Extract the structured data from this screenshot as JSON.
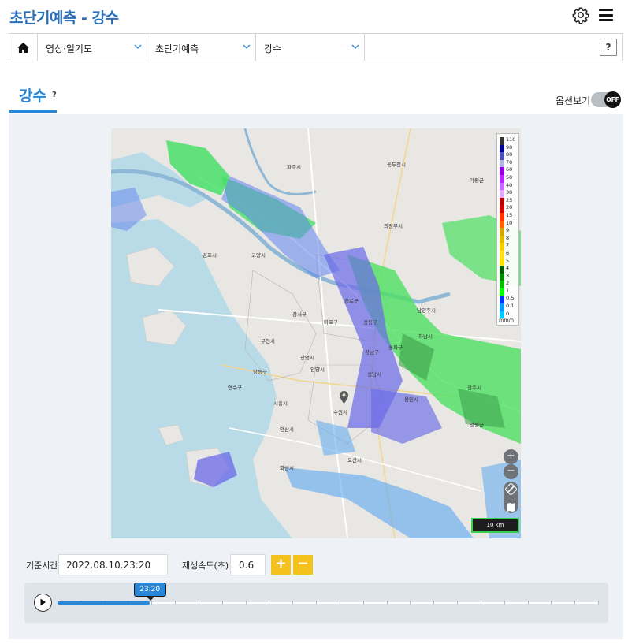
{
  "header": {
    "title": "초단기예측 - 강수",
    "settings_icon": "gear-icon",
    "menu_icon": "hamburger-menu-icon"
  },
  "breadcrumb": {
    "home_icon": "home-icon",
    "items": [
      {
        "label": "영상·일기도"
      },
      {
        "label": "초단기예측"
      },
      {
        "label": "강수"
      }
    ],
    "help_label": "?"
  },
  "tab": {
    "title": "강수",
    "help": "?"
  },
  "options": {
    "label": "옵션보기",
    "toggle_state": "OFF"
  },
  "map": {
    "legend": {
      "values": [
        "110",
        "90",
        "80",
        "70",
        "60",
        "50",
        "40",
        "30",
        "25",
        "20",
        "15",
        "10",
        "9",
        "8",
        "7",
        "6",
        "5",
        "4",
        "3",
        "2",
        "1",
        "0.5",
        "0.1",
        "0"
      ],
      "colors": [
        "#333333",
        "#000390",
        "#4c4eb1",
        "#b3b4de",
        "#9300e4",
        "#b329ff",
        "#c969ff",
        "#e0a9ff",
        "#b40000",
        "#d20000",
        "#ff3200",
        "#ff6600",
        "#ccaa00",
        "#e0b900",
        "#f9cd00",
        "#ffdc1f",
        "#ffe100",
        "#005a00",
        "#008c00",
        "#00be00",
        "#00ff00",
        "#0033ff",
        "#009bf5",
        "#00c8ff"
      ],
      "unit": "mm/h"
    },
    "zoom_in": "+",
    "zoom_out": "−",
    "ruler_icon": "ruler-icon",
    "map_toggle_icon": "map-icon",
    "scale_label": "10 km",
    "place_labels": [
      {
        "name": "파주시"
      },
      {
        "name": "김포시"
      },
      {
        "name": "고양시"
      },
      {
        "name": "의정부시"
      },
      {
        "name": "남양주시"
      },
      {
        "name": "강서구"
      },
      {
        "name": "마포구"
      },
      {
        "name": "종로구"
      },
      {
        "name": "성동구"
      },
      {
        "name": "강남구"
      },
      {
        "name": "송파구"
      },
      {
        "name": "하남시"
      },
      {
        "name": "부천시"
      },
      {
        "name": "광명시"
      },
      {
        "name": "안양시"
      },
      {
        "name": "성남시"
      },
      {
        "name": "광주시"
      },
      {
        "name": "수원시"
      },
      {
        "name": "용인시"
      },
      {
        "name": "시흥시"
      },
      {
        "name": "안산시"
      },
      {
        "name": "남동구"
      },
      {
        "name": "연수구"
      },
      {
        "name": "동두천시"
      },
      {
        "name": "가평군"
      },
      {
        "name": "양평군"
      },
      {
        "name": "오산시"
      },
      {
        "name": "화성시"
      }
    ]
  },
  "controls": {
    "base_time_label": "기준시간",
    "base_time_value": "2022.08.10.23:20",
    "speed_label": "재생속도(초)",
    "speed_value": "0.6",
    "speed_up": "+",
    "speed_down": "−"
  },
  "timeline": {
    "play_icon": "play-icon",
    "current_time": "23:20",
    "progress": 0.17,
    "tick_count": 24
  }
}
